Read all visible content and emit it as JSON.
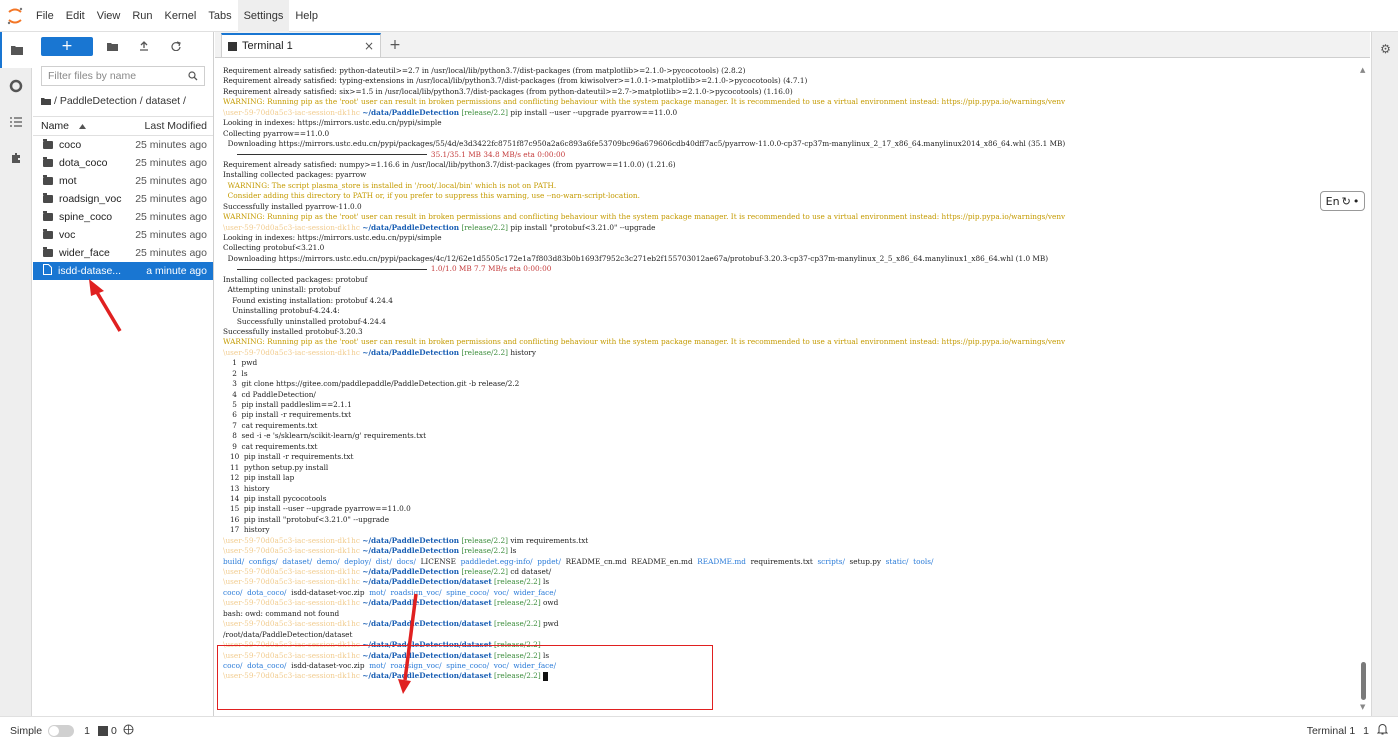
{
  "menubar": {
    "items": [
      "File",
      "Edit",
      "View",
      "Run",
      "Kernel",
      "Tabs",
      "Settings",
      "Help"
    ],
    "active": "Settings"
  },
  "filebrowser": {
    "new_label": "+",
    "filter_placeholder": "Filter files by name",
    "breadcrumb": "/ PaddleDetection / dataset /",
    "col_name": "Name",
    "col_modified": "Last Modified",
    "rows": [
      {
        "name": "coco",
        "modified": "25 minutes ago",
        "kind": "folder"
      },
      {
        "name": "dota_coco",
        "modified": "25 minutes ago",
        "kind": "folder"
      },
      {
        "name": "mot",
        "modified": "25 minutes ago",
        "kind": "folder"
      },
      {
        "name": "roadsign_voc",
        "modified": "25 minutes ago",
        "kind": "folder"
      },
      {
        "name": "spine_coco",
        "modified": "25 minutes ago",
        "kind": "folder"
      },
      {
        "name": "voc",
        "modified": "25 minutes ago",
        "kind": "folder"
      },
      {
        "name": "wider_face",
        "modified": "25 minutes ago",
        "kind": "folder"
      },
      {
        "name": "isdd-datase...",
        "modified": "a minute ago",
        "kind": "file"
      }
    ]
  },
  "tab": {
    "label": "Terminal 1",
    "close": "×",
    "add": "+"
  },
  "ime": {
    "label": "En"
  },
  "terminal": {
    "prompt_user": "\\user-59-70d0a5c3-iac-session-dk1hc",
    "l1": "Requirement already satisfied: python-dateutil>=2.7 in /usr/local/lib/python3.7/dist-packages (from matplotlib>=2.1.0->pycocotools) (2.8.2)",
    "l2": "Requirement already satisfied: typing-extensions in /usr/local/lib/python3.7/dist-packages (from kiwisolver>=1.0.1->matplotlib>=2.1.0->pycocotools) (4.7.1)",
    "l3": "Requirement already satisfied: six>=1.5 in /usr/local/lib/python3.7/dist-packages (from python-dateutil>=2.7->matplotlib>=2.1.0->pycocotools) (1.16.0)",
    "warn": "WARNING: Running pip as the 'root' user can result in broken permissions and conflicting behaviour with the system package manager. It is recommended to use a virtual environment instead: https://pip.pypa.io/warnings/venv",
    "path_pd": "~/data/PaddleDetection",
    "path_ds": "~/data/PaddleDetection/dataset",
    "branch": "[release/2.2]",
    "cmd1": "pip install --user --upgrade pyarrow==11.0.0",
    "l5": "Looking in indexes: https://mirrors.ustc.edu.cn/pypi/simple",
    "l6": "Collecting pyarrow==11.0.0",
    "l7": "  Downloading https://mirrors.ustc.edu.cn/pypi/packages/55/4d/e3d3422fc8751f87c950a2a6c893a6fe53709bc96a679606cdb40dff7ac5/pyarrow-11.0.0-cp37-cp37m-manylinux_2_17_x86_64.manylinux2014_x86_64.whl (35.1 MB)",
    "bar1": "35.1/35.1 MB 34.8 MB/s eta 0:00:00",
    "l9": "Requirement already satisfied: numpy>=1.16.6 in /usr/local/lib/python3.7/dist-packages (from pyarrow==11.0.0) (1.21.6)",
    "l10": "Installing collected packages: pyarrow",
    "l11": "  WARNING: The script plasma_store is installed in '/root/.local/bin' which is not on PATH.",
    "l12": "  Consider adding this directory to PATH or, if you prefer to suppress this warning, use --no-warn-script-location.",
    "l13": "Successfully installed pyarrow-11.0.0",
    "cmd2": "pip install \"protobuf<3.21.0\" --upgrade",
    "l16": "Looking in indexes: https://mirrors.ustc.edu.cn/pypi/simple",
    "l17": "Collecting protobuf<3.21.0",
    "l18": "  Downloading https://mirrors.ustc.edu.cn/pypi/packages/4c/12/62e1d5505c172e1a7f803d83b0b1693f7952c3c271eb2f155703012ae67a/protobuf-3.20.3-cp37-cp37m-manylinux_2_5_x86_64.manylinux1_x86_64.whl (1.0 MB)",
    "bar2": "1.0/1.0 MB 7.7 MB/s eta 0:00:00",
    "l20": "Installing collected packages: protobuf",
    "l21": "  Attempting uninstall: protobuf",
    "l22": "    Found existing installation: protobuf 4.24.4",
    "l23": "    Uninstalling protobuf-4.24.4:",
    "l24": "      Successfully uninstalled protobuf-4.24.4",
    "l25": "Successfully installed protobuf-3.20.3",
    "cmd3": "history",
    "history": [
      "    1  pwd",
      "    2  ls",
      "    3  git clone https://gitee.com/paddlepaddle/PaddleDetection.git -b release/2.2",
      "    4  cd PaddleDetection/",
      "    5  pip install paddleslim==2.1.1",
      "    6  pip install -r requirements.txt",
      "    7  cat requirements.txt",
      "    8  sed -i -e 's/sklearn/scikit-learn/g' requirements.txt",
      "    9  cat requirements.txt",
      "   10  pip install -r requirements.txt",
      "   11  python setup.py install",
      "   12  pip install lap",
      "   13  history",
      "   14  pip install pycocotools",
      "   15  pip install --user --upgrade pyarrow==11.0.0",
      "   16  pip install \"protobuf<3.21.0\" --upgrade",
      "   17  history"
    ],
    "cmd4": "vim requirements.txt",
    "cmd5": "ls",
    "ls1": [
      "build/",
      "configs/",
      "dataset/",
      "demo/",
      "deploy/",
      "dist/",
      "docs/",
      "LICENSE",
      "paddledet.egg-info/",
      "ppdet/",
      "README_cn.md",
      "README_en.md",
      "README.md",
      "requirements.txt",
      "scripts/",
      "setup.py",
      "static/",
      "tools/"
    ],
    "cmd6": "cd dataset/",
    "cmd7": "ls",
    "ls2": [
      "coco/",
      "dota_coco/",
      "isdd-dataset-voc.zip",
      "mot/",
      "roadsign_voc/",
      "spine_coco/",
      "voc/",
      "wider_face/"
    ],
    "cmd8": "owd",
    "err": "bash: owd: command not found",
    "cmd9": "pwd",
    "pwd_out": "/root/data/PaddleDetection/dataset",
    "cmd10": "",
    "cmd11": "ls"
  },
  "statusbar": {
    "mode": "Simple",
    "num1": "1",
    "num2": "0",
    "right_label": "Terminal 1",
    "right_num": "1"
  },
  "colors": {
    "accent": "#1976d2",
    "warning": "#c49a00",
    "annotation": "#e02020"
  }
}
